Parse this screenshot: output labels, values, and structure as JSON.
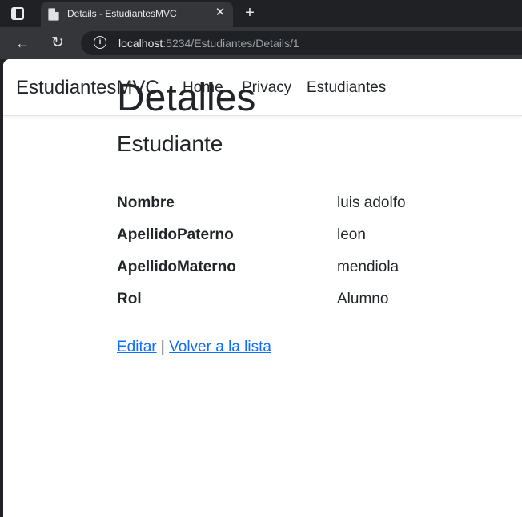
{
  "browser": {
    "tab_title": "Details - EstudiantesMVC",
    "url_host": "localhost",
    "url_path": ":5234/Estudiantes/Details/1"
  },
  "navbar": {
    "brand": "EstudiantesMVC",
    "links": [
      "Home",
      "Privacy",
      "Estudiantes"
    ]
  },
  "page": {
    "title": "Detalles",
    "subtitle": "Estudiante",
    "fields": [
      {
        "label": "Nombre",
        "value": "luis adolfo"
      },
      {
        "label": "ApellidoPaterno",
        "value": "leon"
      },
      {
        "label": "ApellidoMaterno",
        "value": "mendiola"
      },
      {
        "label": "Rol",
        "value": "Alumno"
      }
    ],
    "actions": {
      "edit": "Editar",
      "separator": "|",
      "back": "Volver a la lista"
    }
  }
}
